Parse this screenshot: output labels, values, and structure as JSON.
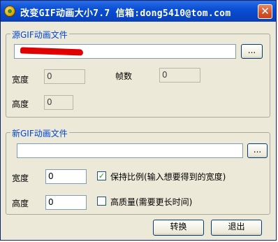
{
  "window": {
    "title": "改变GIF动画大小7.7  信箱:dong5410@tom.com",
    "close_glyph": "✕"
  },
  "source_group": {
    "legend": "源GIF动画文件",
    "path_value": "",
    "browse_label": "...",
    "width_label": "宽度",
    "width_value": "0",
    "frames_label": "帧数",
    "frames_value": "0",
    "height_label": "高度",
    "height_value": "0"
  },
  "new_group": {
    "legend": "新GIF动画文件",
    "path_value": "",
    "browse_label": "...",
    "width_label": "宽度",
    "width_value": "0",
    "keep_ratio_label": "保持比例(输入想要得到的宽度)",
    "keep_ratio_checked": true,
    "height_label": "高度",
    "height_value": "0",
    "high_quality_label": "高质量(需要更长时间)",
    "high_quality_checked": false
  },
  "buttons": {
    "convert_label": "转换",
    "exit_label": "退出"
  },
  "icons": {
    "app": "app-icon",
    "close": "close-icon",
    "check": "checkmark-icon"
  },
  "colors": {
    "titlebar": "#0a4fd4",
    "legend_text": "#0046d5",
    "redaction": "#e00000",
    "dialog_face": "#ece9d8"
  }
}
